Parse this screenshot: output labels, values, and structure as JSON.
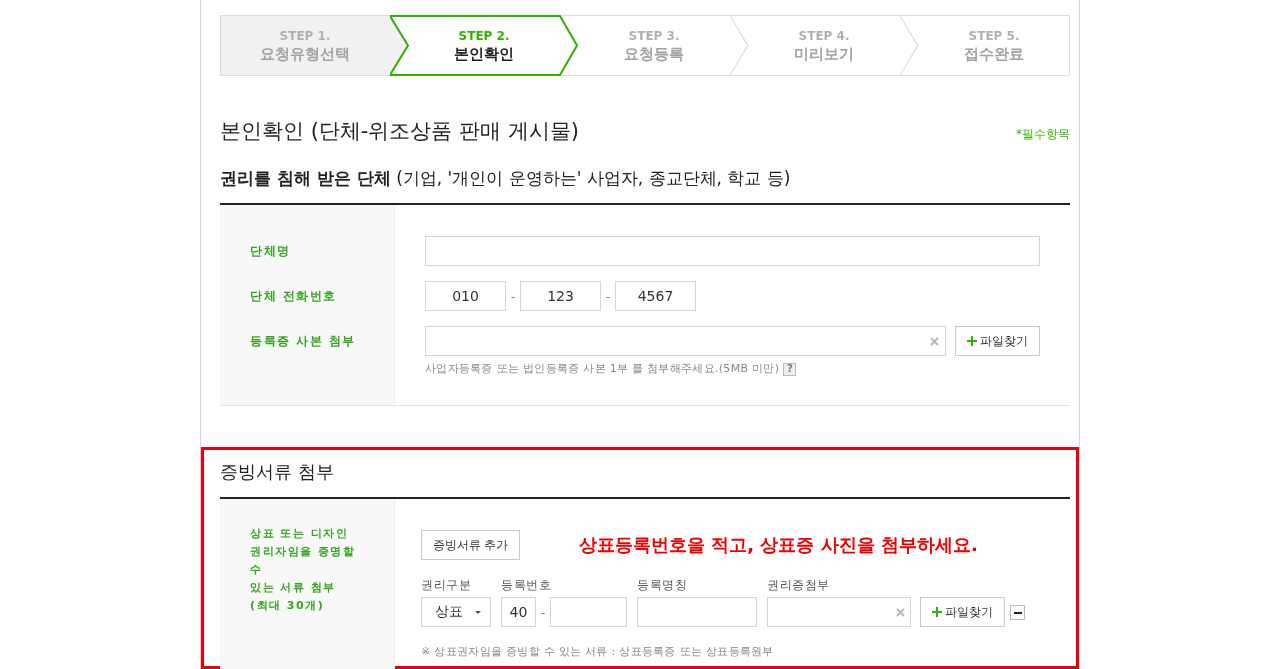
{
  "steps": [
    {
      "number": "STEP 1.",
      "label": "요청유형선택",
      "selected": false,
      "completed": true
    },
    {
      "number": "STEP 2.",
      "label": "본인확인",
      "selected": true,
      "completed": false
    },
    {
      "number": "STEP 3.",
      "label": "요청등록",
      "selected": false,
      "completed": false
    },
    {
      "number": "STEP 4.",
      "label": "미리보기",
      "selected": false,
      "completed": false
    },
    {
      "number": "STEP 5.",
      "label": "접수완료",
      "selected": false,
      "completed": false
    }
  ],
  "page_title": {
    "title": "본인확인 (단체-위조상품 판매 게시물)",
    "required_note": "*필수항목"
  },
  "section_title": "**권리를 침해 받은 단체** (기업, '개인이 운영하는' 사업자, 종교단체, 학교 등)",
  "org_form": {
    "rows": [
      {
        "kind": "text",
        "label": "단체명"
      },
      {
        "kind": "phone",
        "label": "단체 전화번호",
        "parts": [
          "010",
          "123",
          "4567"
        ],
        "separators": [
          "-",
          "-"
        ]
      },
      {
        "kind": "file",
        "label": "등록증 사본 첨부",
        "button": "파일찾기",
        "hint": "사업자등록증 또는 법인등록증 사본 1부 를 첨부해주세요.(5MB 미만)",
        "help": "?"
      }
    ]
  },
  "evidence": {
    "highlighted": true,
    "title": "증빙서류 첨부",
    "label_lines": [
      "상표 또는 디자인",
      "권리자임을 증명할",
      "수",
      "있는 서류 첨부",
      "(최대 30개)"
    ],
    "add_button": "증빙서류 추가",
    "annotation": "상표등록번호을 적고, 상표증 사진을 첨부하세요.",
    "columns": [
      "권리구분",
      "등록번호",
      "등록명칭",
      "권리증첨부"
    ],
    "cells": [
      {
        "kind": "select",
        "value": "상표"
      },
      {
        "kind": "number",
        "prefix": "40",
        "separator": "-"
      },
      {
        "kind": "text"
      },
      {
        "kind": "file"
      }
    ],
    "button": "파일찾기",
    "note": "※ 상표권자임을 증빙할 수 있는 서류 : 상표등록증 또는 상표등록원부"
  }
}
